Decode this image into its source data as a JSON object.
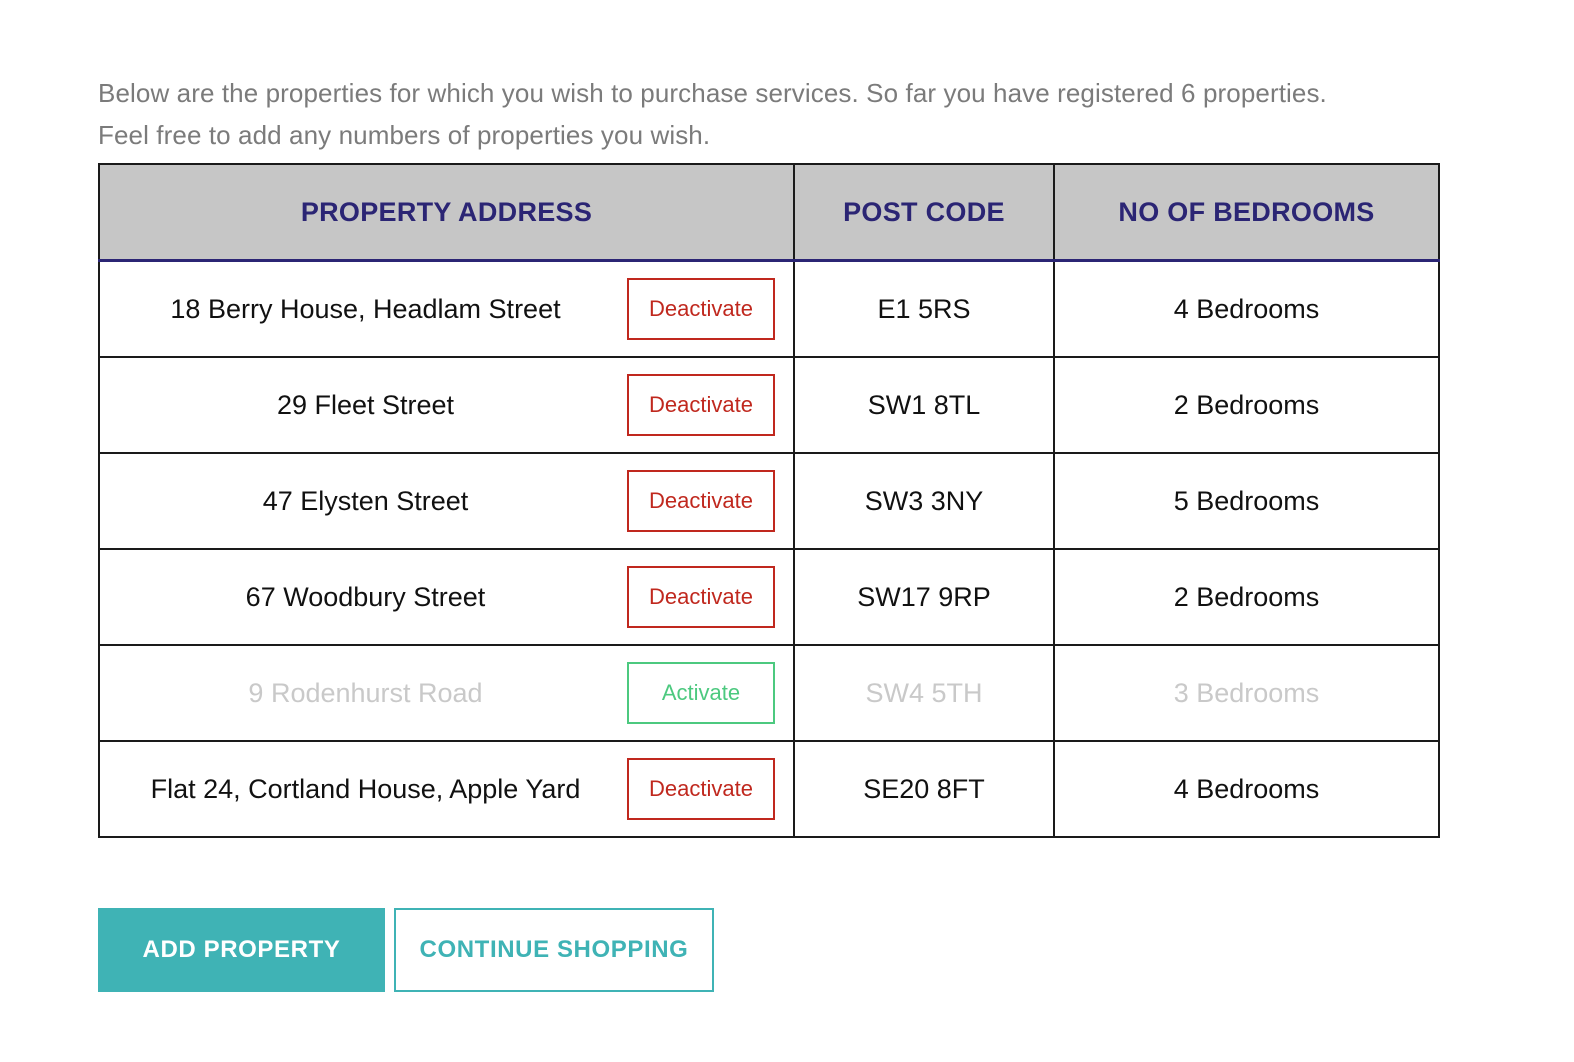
{
  "intro": {
    "text": "Below are the properties for which you wish to purchase services. So far you have registered 6 properties. Feel free to add any numbers of properties you wish."
  },
  "table": {
    "columns": {
      "address": "PROPERTY ADDRESS",
      "postcode": "POST CODE",
      "bedrooms": "NO OF BEDROOMS"
    },
    "rows": [
      {
        "address": "18 Berry House, Headlam Street",
        "postcode": "E1 5RS",
        "bedrooms": "4 Bedrooms",
        "action_label": "Deactivate",
        "state": "active"
      },
      {
        "address": "29 Fleet Street",
        "postcode": "SW1 8TL",
        "bedrooms": "2 Bedrooms",
        "action_label": "Deactivate",
        "state": "active"
      },
      {
        "address": "47 Elysten Street",
        "postcode": "SW3 3NY",
        "bedrooms": "5 Bedrooms",
        "action_label": "Deactivate",
        "state": "active"
      },
      {
        "address": "67 Woodbury Street",
        "postcode": "SW17 9RP",
        "bedrooms": "2 Bedrooms",
        "action_label": "Deactivate",
        "state": "active"
      },
      {
        "address": "9 Rodenhurst Road",
        "postcode": "SW4 5TH",
        "bedrooms": "3 Bedrooms",
        "action_label": "Activate",
        "state": "inactive"
      },
      {
        "address": "Flat 24, Cortland House, Apple Yard",
        "postcode": "SE20 8FT",
        "bedrooms": "4 Bedrooms",
        "action_label": "Deactivate",
        "state": "active"
      }
    ]
  },
  "actions": {
    "add_property": "ADD PROPERTY",
    "continue_shopping": "CONTINUE SHOPPING"
  },
  "colors": {
    "accent_teal": "#3fb3b5",
    "header_navy": "#2b2574",
    "header_grey": "#c6c6c6",
    "deactivate_red": "#c0281e",
    "activate_green": "#4cc97f",
    "muted_text": "#c9c9c9",
    "body_text_grey": "#7b7b7b"
  }
}
